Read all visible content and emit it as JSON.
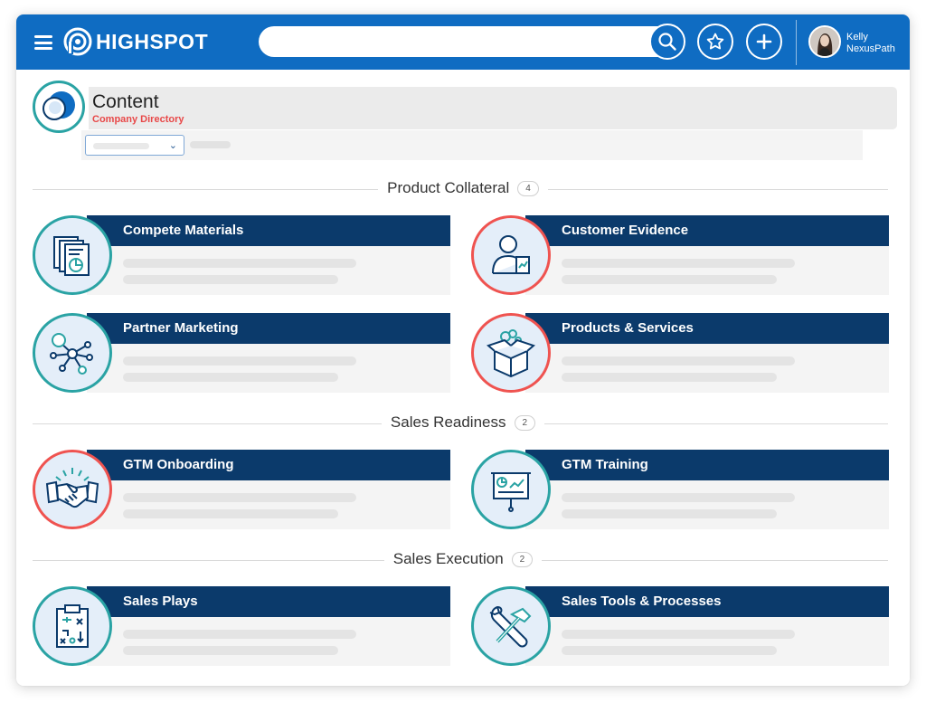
{
  "app": {
    "logo_text": "HIGHSPOT",
    "search": {
      "value": "",
      "placeholder": ""
    },
    "user": {
      "first_name": "Kelly",
      "last_name": "NexusPath"
    }
  },
  "header": {
    "title": "Content",
    "subtitle": "Company Directory"
  },
  "colors": {
    "topbar": "#0f6cc2",
    "banner": "#0b3a6b",
    "teal_ring": "#2aa3a4",
    "red_ring": "#ef5350",
    "subtitle": "#e84848"
  },
  "sections": [
    {
      "title": "Product Collateral",
      "count": "4",
      "cards": [
        {
          "title": "Compete Materials",
          "icon": "documents-chart-icon",
          "ring": "teal"
        },
        {
          "title": "Customer Evidence",
          "icon": "person-document-icon",
          "ring": "red"
        },
        {
          "title": "Partner Marketing",
          "icon": "network-nodes-icon",
          "ring": "teal"
        },
        {
          "title": "Products & Services",
          "icon": "open-box-icon",
          "ring": "red"
        }
      ]
    },
    {
      "title": "Sales Readiness",
      "count": "2",
      "cards": [
        {
          "title": "GTM Onboarding",
          "icon": "handshake-icon",
          "ring": "red"
        },
        {
          "title": "GTM Training",
          "icon": "presentation-board-icon",
          "ring": "teal"
        }
      ]
    },
    {
      "title": "Sales Execution",
      "count": "2",
      "cards": [
        {
          "title": "Sales Plays",
          "icon": "clipboard-plays-icon",
          "ring": "teal"
        },
        {
          "title": "Sales Tools & Processes",
          "icon": "wrench-hammer-icon",
          "ring": "teal"
        }
      ]
    }
  ]
}
